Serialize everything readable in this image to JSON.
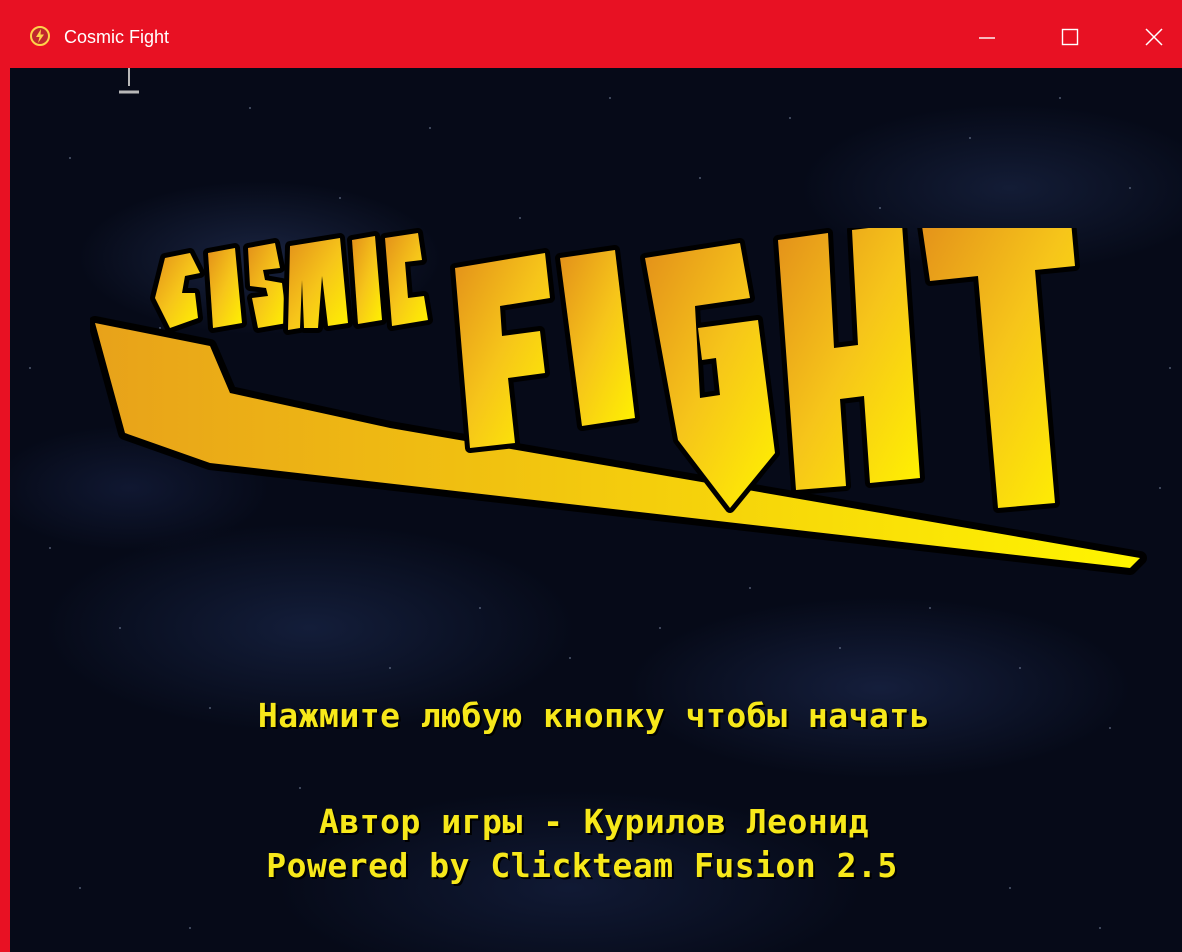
{
  "window": {
    "title": "Cosmic Fight",
    "app_icon": "flash-icon",
    "controls": {
      "minimize_icon": "minimize-icon",
      "maximize_icon": "maximize-icon",
      "close_icon": "close-icon"
    },
    "titlebar_color": "#e81123"
  },
  "game": {
    "logo": {
      "word1": "COSMIC",
      "word2": "FIGHT",
      "fill_colors": [
        "#e89a1c",
        "#fff200"
      ]
    },
    "prompt": "Нажмите любую кнопку чтобы начать",
    "credits": [
      "Автор игры - Курилов Леонид",
      "Powered by Clickteam Fusion 2.5"
    ],
    "text_color": "#f7e81a",
    "background_color": "#060a18"
  }
}
